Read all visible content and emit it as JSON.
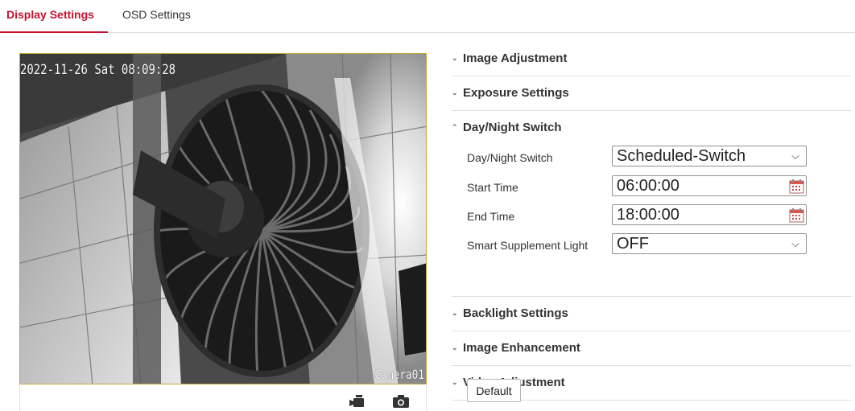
{
  "tabs": {
    "display": "Display Settings",
    "osd": "OSD Settings"
  },
  "video": {
    "timestamp": "2022-11-26 Sat 08:09:28",
    "camera_name": "Camera01"
  },
  "icons": {
    "record": "video-camera-icon",
    "snapshot": "camera-icon",
    "calendar": "calendar-icon"
  },
  "sections": {
    "image_adjustment": "Image Adjustment",
    "exposure": "Exposure Settings",
    "day_night": "Day/Night Switch",
    "backlight": "Backlight Settings",
    "enhancement": "Image Enhancement",
    "video_adjustment": "Video Adjustment"
  },
  "day_night": {
    "switch_label": "Day/Night Switch",
    "switch_value": "Scheduled-Switch",
    "start_label": "Start Time",
    "start_value": "06:00:00",
    "end_label": "End Time",
    "end_value": "18:00:00",
    "light_label": "Smart Supplement Light",
    "light_value": "OFF"
  },
  "buttons": {
    "default": "Default"
  },
  "colors": {
    "accent": "#c8102e",
    "video_border": "#c7a93a"
  }
}
